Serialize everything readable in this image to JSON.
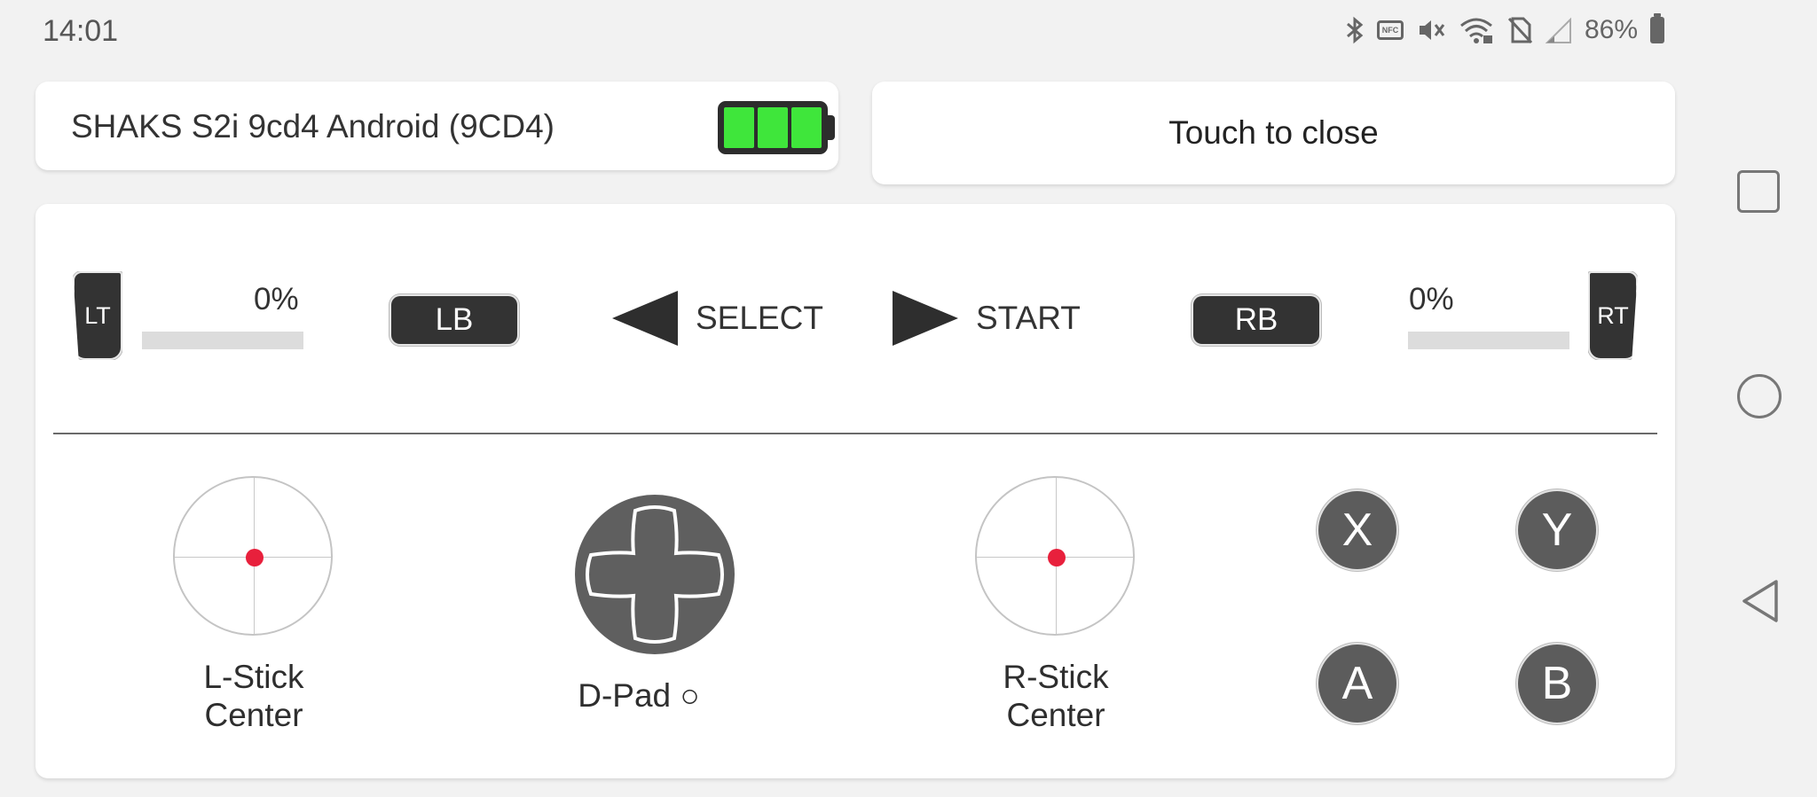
{
  "status_bar": {
    "time": "14:01",
    "battery_percent": "86%",
    "icons": [
      "bluetooth-icon",
      "nfc-icon",
      "vibrate-icon",
      "wifi-icon",
      "no-sim-icon",
      "signal-icon",
      "battery-icon"
    ],
    "nfc_label": "NFC"
  },
  "device": {
    "name": "SHAKS S2i 9cd4 Android (9CD4)",
    "battery_level": 1.0,
    "battery_color": "#3fe63b"
  },
  "close_button": {
    "label": "Touch to close"
  },
  "controller": {
    "lt": {
      "label": "LT",
      "percent_text": "0%",
      "value": 0
    },
    "rt": {
      "label": "RT",
      "percent_text": "0%",
      "value": 0
    },
    "lb": {
      "label": "LB"
    },
    "rb": {
      "label": "RB"
    },
    "select": {
      "label": "SELECT"
    },
    "start": {
      "label": "START"
    },
    "left_stick": {
      "line1": "L-Stick",
      "line2": "Center",
      "x": 0,
      "y": 0
    },
    "right_stick": {
      "line1": "R-Stick",
      "line2": "Center",
      "x": 0,
      "y": 0
    },
    "dpad": {
      "label": "D-Pad ○"
    },
    "face_buttons": {
      "x": "X",
      "y": "Y",
      "a": "A",
      "b": "B"
    },
    "stick_dot_color": "#e8203c"
  },
  "nav": {
    "icons": [
      "recents-icon",
      "home-icon",
      "back-icon"
    ]
  }
}
